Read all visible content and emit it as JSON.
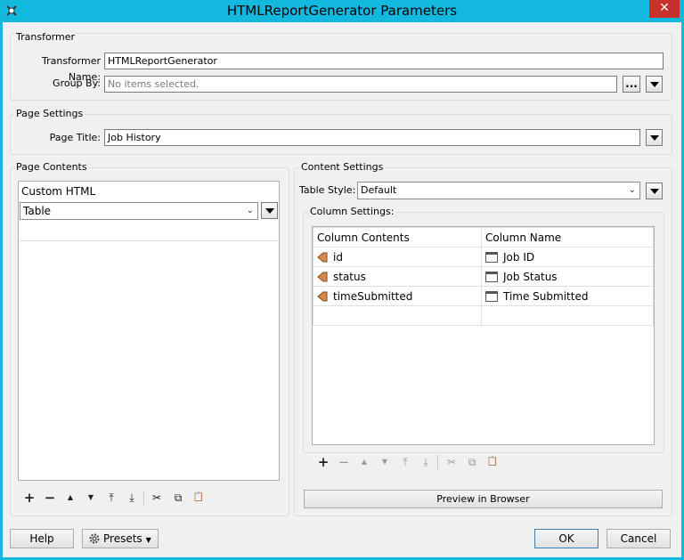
{
  "window": {
    "title": "HTMLReportGenerator Parameters",
    "close": "✕"
  },
  "transformer": {
    "group_label": "Transformer",
    "name_label": "Transformer Name:",
    "name_value": "HTMLReportGenerator",
    "groupby_label": "Group By:",
    "groupby_placeholder": "No items selected.",
    "ellipsis": "..."
  },
  "page_settings": {
    "group_label": "Page Settings",
    "title_label": "Page Title:",
    "title_value": "Job History"
  },
  "page_contents": {
    "group_label": "Page Contents",
    "items": [
      {
        "label": "Custom HTML"
      },
      {
        "label": "Table"
      }
    ],
    "toolbar": {
      "add": "+",
      "remove": "−",
      "up": "▲",
      "down": "▼",
      "top": "⤒",
      "bottom": "⤓",
      "cut": "✂",
      "copy": "⧉",
      "paste": "📋"
    }
  },
  "content_settings": {
    "group_label": "Content Settings",
    "table_style_label": "Table Style:",
    "table_style_value": "Default",
    "column_settings_label": "Column Settings:",
    "headers": {
      "contents": "Column Contents",
      "name": "Column Name"
    },
    "rows": [
      {
        "contents": "id",
        "name": "Job ID"
      },
      {
        "contents": "status",
        "name": "Job Status"
      },
      {
        "contents": "timeSubmitted",
        "name": "Time Submitted"
      }
    ],
    "preview_label": "Preview in Browser"
  },
  "footer": {
    "help": "Help",
    "presets": "Presets",
    "ok": "OK",
    "cancel": "Cancel"
  }
}
